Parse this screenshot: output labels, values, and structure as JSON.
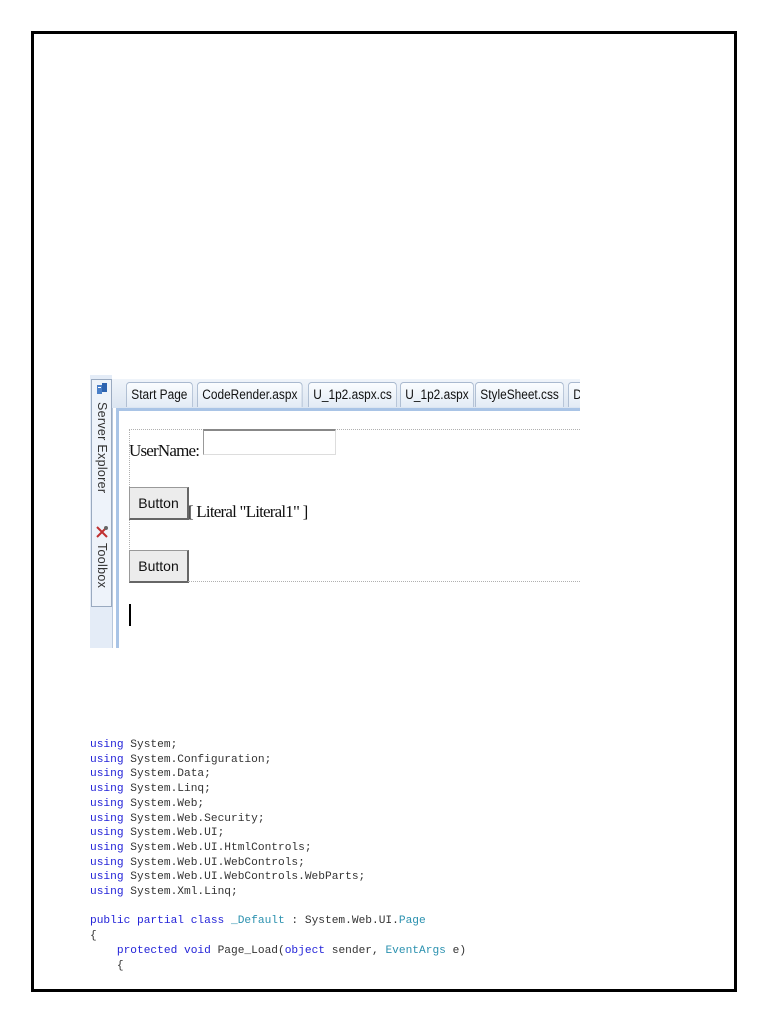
{
  "ide": {
    "side_panels": [
      "Server Explorer",
      "Toolbox"
    ],
    "tabs": [
      "Start Page",
      "CodeRender.aspx",
      "U_1p2.aspx.cs",
      "U_1p2.aspx",
      "StyleSheet.css",
      "D"
    ],
    "designer": {
      "username_label": "UserName:",
      "username_value": "",
      "button1_label": "Button",
      "literal_text": "[ Literal \"Literal1\" ]",
      "button2_label": "Button"
    }
  },
  "code": {
    "colors": {
      "keyword": "#2323d8",
      "type": "#2b91af",
      "text": "#333333"
    },
    "lines": [
      [
        [
          "kw",
          "using"
        ],
        [
          "tx",
          " System;"
        ]
      ],
      [
        [
          "kw",
          "using"
        ],
        [
          "tx",
          " System.Configuration;"
        ]
      ],
      [
        [
          "kw",
          "using"
        ],
        [
          "tx",
          " System.Data;"
        ]
      ],
      [
        [
          "kw",
          "using"
        ],
        [
          "tx",
          " System.Linq;"
        ]
      ],
      [
        [
          "kw",
          "using"
        ],
        [
          "tx",
          " System.Web;"
        ]
      ],
      [
        [
          "kw",
          "using"
        ],
        [
          "tx",
          " System.Web.Security;"
        ]
      ],
      [
        [
          "kw",
          "using"
        ],
        [
          "tx",
          " System.Web.UI;"
        ]
      ],
      [
        [
          "kw",
          "using"
        ],
        [
          "tx",
          " System.Web.UI.HtmlControls;"
        ]
      ],
      [
        [
          "kw",
          "using"
        ],
        [
          "tx",
          " System.Web.UI.WebControls;"
        ]
      ],
      [
        [
          "kw",
          "using"
        ],
        [
          "tx",
          " System.Web.UI.WebControls.WebParts;"
        ]
      ],
      [
        [
          "kw",
          "using"
        ],
        [
          "tx",
          " System.Xml.Linq;"
        ]
      ],
      [],
      [
        [
          "kw",
          "public partial class"
        ],
        [
          "tx",
          " "
        ],
        [
          "ty",
          "_Default"
        ],
        [
          "tx",
          " : System.Web.UI."
        ],
        [
          "ty",
          "Page"
        ]
      ],
      [
        [
          "tx",
          "{"
        ]
      ],
      [
        [
          "tx",
          "    "
        ],
        [
          "kw",
          "protected void"
        ],
        [
          "tx",
          " Page_Load("
        ],
        [
          "kw",
          "object"
        ],
        [
          "tx",
          " sender, "
        ],
        [
          "ty",
          "EventArgs"
        ],
        [
          "tx",
          " e)"
        ]
      ],
      [
        [
          "tx",
          "    {"
        ]
      ]
    ]
  }
}
